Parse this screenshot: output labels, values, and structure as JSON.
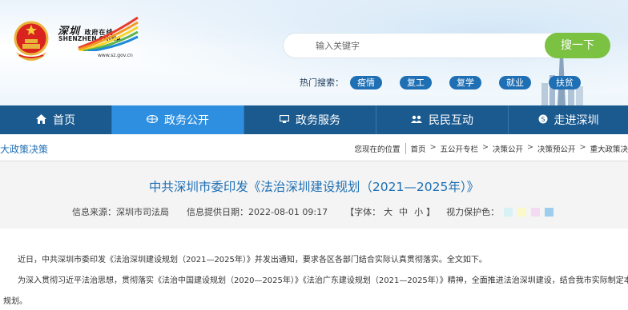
{
  "header": {
    "logo_cn": "深圳",
    "logo_cn_sub": "政府在线",
    "logo_en": "SHENZHEN CHINA",
    "logo_url": "www.sz.gov.cn"
  },
  "search": {
    "placeholder": "输入关键字",
    "button_label": "搜一下"
  },
  "hot": {
    "label": "热门搜索：",
    "items": [
      "疫情",
      "复工",
      "复学",
      "就业",
      "扶贫"
    ]
  },
  "nav": {
    "items": [
      {
        "label": "首页",
        "icon": "home-icon"
      },
      {
        "label": "政务公开",
        "icon": "globe-icon",
        "active": true
      },
      {
        "label": "政务服务",
        "icon": "monitor-icon"
      },
      {
        "label": "民民互动",
        "icon": "people-icon"
      },
      {
        "label": "走进深圳",
        "icon": "sz-icon"
      }
    ]
  },
  "breadcrumb": {
    "section_title": "大政策决策",
    "location_label": "您现在的位置",
    "items": [
      "首页",
      "五公开专栏",
      "决策公开",
      "决策预公开",
      "重大政策决"
    ]
  },
  "article": {
    "title": "中共深圳市委印发《法治深圳建设规划（2021—2025年）》",
    "source": "信息来源：深圳市司法局",
    "date": "信息提供日期：2022-08-01 09:17",
    "font_label": "【字体：",
    "font_sizes": [
      "大",
      "中",
      "小"
    ],
    "font_close": "】",
    "eye_care_label": "视力保护色：",
    "eye_care_colors": [
      "#d7f1f5",
      "#fbf8c9",
      "#f3dbf3",
      "#9ecdee"
    ]
  },
  "body": {
    "paragraphs": [
      "近日，中共深圳市委印发《法治深圳建设规划（2021—2025年）》并发出通知，要求各区各部门结合实际认真贯彻落实。全文如下。",
      "为深入贯彻习近平法治思想，贯彻落实《法治中国建设规划（2020—2025年）》《法治广东建设规划（2021—2025年）》精神，全面推进法治深圳建设，结合我市实际制定本",
      "规划。"
    ]
  },
  "colors": {
    "nav_bg": "#1b5a8f",
    "nav_active": "#2e8fe0",
    "search_button": "#7bc142",
    "hot_tag": "#1f6fb4",
    "title_color": "#1f6fb4"
  }
}
